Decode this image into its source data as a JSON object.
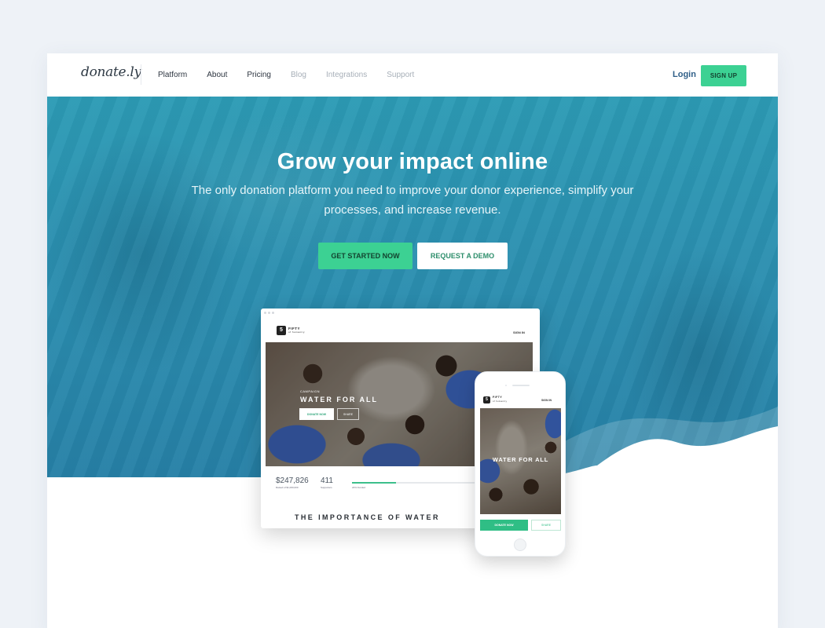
{
  "nav": {
    "logo": "donate.ly",
    "links": [
      {
        "label": "Platform",
        "muted": false
      },
      {
        "label": "About",
        "muted": false
      },
      {
        "label": "Pricing",
        "muted": false
      },
      {
        "label": "Blog",
        "muted": true
      },
      {
        "label": "Integrations",
        "muted": true
      },
      {
        "label": "Support",
        "muted": true
      }
    ],
    "login": "Login",
    "signup": "SIGN UP"
  },
  "hero": {
    "title": "Grow your impact online",
    "subtitle": "The only donation platform you need to improve your donor experience, simplify your processes, and increase revenue.",
    "primary_cta": "GET STARTED NOW",
    "secondary_cta": "REQUEST A DEMO"
  },
  "desktop_mockup": {
    "brand": "FIFTY",
    "brand_sub": "of humanity",
    "sign_in": "SIGN IN",
    "campaign_label": "CAMPAIGN",
    "campaign_title": "WATER FOR ALL",
    "donate_label": "DONATE NOW",
    "share_label": "SHARE",
    "raised_amount": "$247,826",
    "raised_label": "Raised of $1,000,000",
    "supporters": "411",
    "supporters_label": "Supporters",
    "funded_percent": 24,
    "funded_label": "24% Funded",
    "section_heading": "THE IMPORTANCE OF WATER"
  },
  "phone_mockup": {
    "brand": "FIFTY",
    "brand_sub": "of humanity",
    "sign_in": "SIGN IN",
    "campaign_title": "WATER FOR ALL",
    "donate_label": "DONATE NOW",
    "share_label": "SHARE"
  },
  "colors": {
    "accent_green": "#3cd193",
    "hero_teal": "#2b8fb0",
    "login_blue": "#2f5f88"
  }
}
